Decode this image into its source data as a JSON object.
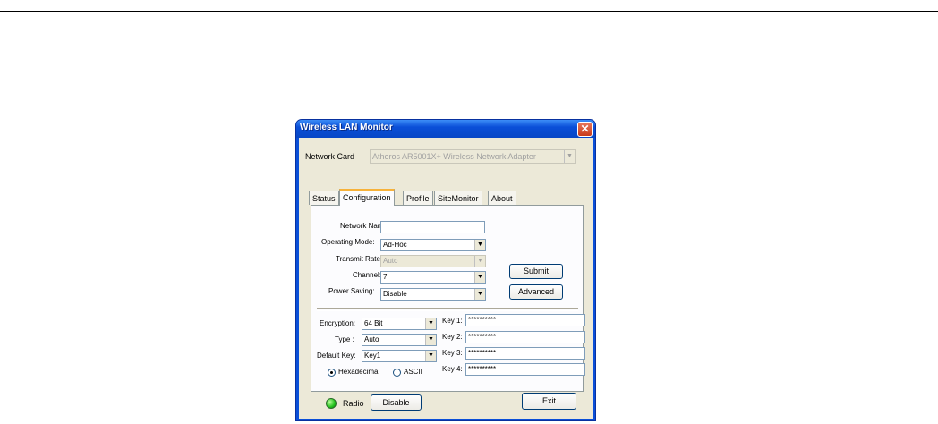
{
  "window": {
    "title": "Wireless LAN Monitor"
  },
  "network_card": {
    "label": "Network Card",
    "value": "Atheros AR5001X+ Wireless Network Adapter"
  },
  "tabs": [
    {
      "label": "Status"
    },
    {
      "label": "Configuration",
      "active": true
    },
    {
      "label": "Profile"
    },
    {
      "label": "SiteMonitor"
    },
    {
      "label": "About"
    }
  ],
  "config": {
    "network_name": {
      "label": "Network Name:",
      "value": ""
    },
    "operating_mode": {
      "label": "Operating Mode:",
      "value": "Ad-Hoc"
    },
    "transmit_rate": {
      "label": "Transmit Rate:",
      "value": "Auto"
    },
    "channel": {
      "label": "Channel:",
      "value": "7"
    },
    "power_saving": {
      "label": "Power Saving:",
      "value": "Disable"
    },
    "submit_label": "Submit",
    "advanced_label": "Advanced"
  },
  "security": {
    "encryption": {
      "label": "Encryption:",
      "value": "64 Bit"
    },
    "type": {
      "label": "Type :",
      "value": "Auto"
    },
    "default_key": {
      "label": "Default Key:",
      "value": "Key1"
    },
    "keys": [
      {
        "label": "Key 1:",
        "value": "**********"
      },
      {
        "label": "Key 2:",
        "value": "**********"
      },
      {
        "label": "Key 3:",
        "value": "**********"
      },
      {
        "label": "Key 4:",
        "value": "**********"
      }
    ],
    "format": {
      "hex_label": "Hexadecimal",
      "ascii_label": "ASCII",
      "selected": "Hexadecimal"
    }
  },
  "footer": {
    "radio_label": "Radio",
    "radio_button": "Disable",
    "exit_label": "Exit"
  },
  "colors": {
    "titlebar": "#0a4fd8",
    "face": "#ece9d8",
    "radio_led": "#22c21c"
  }
}
